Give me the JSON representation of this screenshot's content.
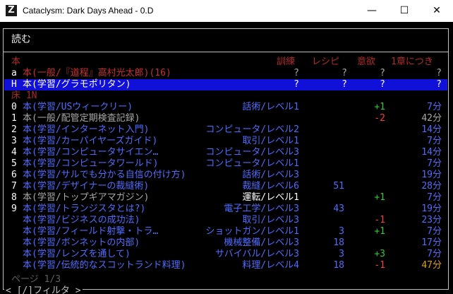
{
  "window": {
    "title": "Cataclysm: Dark Days Ahead - 0.D",
    "icon_letter": "Z",
    "min": "—",
    "max": "☐",
    "close": "✕"
  },
  "heading": "読む",
  "table_header": {
    "section": "本",
    "train": "訓練",
    "recipe": "レシピ",
    "fun": "意欲",
    "time": "1章につき"
  },
  "inventory": [
    {
      "key": "a",
      "name": "本(一般/『道程』高村光太郎)(16)",
      "train": "?",
      "recipe": "?",
      "fun": "?",
      "time": "?"
    },
    {
      "key": "H",
      "name": "本(学習/グラモポリタン)",
      "train": "?",
      "recipe": "?",
      "fun": "?",
      "time": "?"
    }
  ],
  "floor_header": "床 1N",
  "floor": [
    {
      "key": "0",
      "name": "本(学習/USウィークリー)",
      "skill": "話術/レベル1",
      "recipe": "",
      "fun": "+1",
      "time": "7分"
    },
    {
      "key": "1",
      "name": "本(一般/配管定期検査記録)",
      "skill": "",
      "recipe": "",
      "fun": "-2",
      "time": "42分"
    },
    {
      "key": "2",
      "name": "本(学習/インターネット入門)",
      "skill": "コンピュータ/レベル2",
      "recipe": "",
      "fun": "",
      "time": "14分"
    },
    {
      "key": "3",
      "name": "本(学習/カーパイヤーズガイド)",
      "skill": "取引/レベル1",
      "recipe": "",
      "fun": "",
      "time": "7分"
    },
    {
      "key": "4",
      "name": "本(学習/コンピュータサイエン…",
      "skill": "コンピュータ/レベル3",
      "recipe": "",
      "fun": "",
      "time": "14分"
    },
    {
      "key": "5",
      "name": "本(学習/コンピュータワールド)",
      "skill": "コンピュータ/レベル1",
      "recipe": "",
      "fun": "",
      "time": "7分"
    },
    {
      "key": "6",
      "name": "本(学習/サルでも分かる自信の付け方)",
      "skill": "話術/レベル3",
      "recipe": "",
      "fun": "",
      "time": "19分"
    },
    {
      "key": "7",
      "name": "本(学習/デザイナーの裁縫術)",
      "skill": "裁縫/レベル6",
      "recipe": "51",
      "fun": "",
      "time": "28分"
    },
    {
      "key": "8",
      "name": "本(学習/トップギアマガジン)",
      "skill": "運転/レベル1",
      "recipe": "",
      "fun": "+1",
      "time": "7分"
    },
    {
      "key": "9",
      "name": "本(学習/トランジスタとは?)",
      "skill": "電子工学/レベル3",
      "recipe": "43",
      "fun": "",
      "time": "19分"
    },
    {
      "key": "",
      "name": "本(学習/ビジネスの成功法)",
      "skill": "取引/レベル3",
      "recipe": "",
      "fun": "-1",
      "time": "23分"
    },
    {
      "key": "",
      "name": "本(学習/フィールド射撃・トラ…",
      "skill": "ショットガン/レベル1",
      "recipe": "3",
      "fun": "+1",
      "time": "7分"
    },
    {
      "key": "",
      "name": "本(学習/ボンネットの内部)",
      "skill": "機械整備/レベル3",
      "recipe": "18",
      "fun": "",
      "time": "17分"
    },
    {
      "key": "",
      "name": "本(学習/レンズを通して)",
      "skill": "サバイバル/レベル3",
      "recipe": "3",
      "fun": "+3",
      "time": "7分"
    },
    {
      "key": "",
      "name": "本(学習/伝統的なスコットランド料理)",
      "skill": "料理/レベル4",
      "recipe": "18",
      "fun": "-1",
      "time": "47分"
    }
  ],
  "page_label": "ページ 1/3",
  "filter_label": "< [/]フィルタ >",
  "colors": {
    "header_red": "#b02a2a",
    "highlight": "#1010d8",
    "item_blue": "#4f6cff",
    "green": "#32c832",
    "red": "#ff3a3a",
    "orange": "#e0a000"
  }
}
